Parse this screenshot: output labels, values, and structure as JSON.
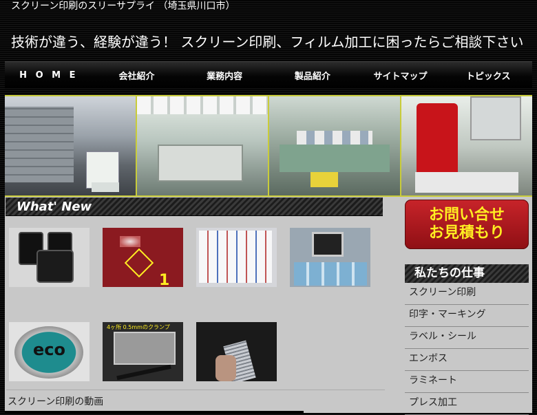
{
  "header": {
    "tagline": "スクリーン印刷のスリーサプライ （埼玉県川口市）",
    "headline": "技術が違う、経験が違う！ スクリーン印刷、フィルム加工に困ったらご相談下さい"
  },
  "nav": {
    "items": [
      {
        "label": "H O M E"
      },
      {
        "label": "会社紹介"
      },
      {
        "label": "業務内容"
      },
      {
        "label": "製品紹介"
      },
      {
        "label": "サイトマップ"
      },
      {
        "label": "トピックス"
      }
    ]
  },
  "main": {
    "whats_new_label": "What' New",
    "video_title": "スクリーン印刷の動画",
    "thumb_texts": {
      "mark_number": "1",
      "eco": "eco",
      "caption": "4ヶ所 0.5mmのクランプ"
    }
  },
  "sidebar": {
    "contact_line1": "お問い合せ",
    "contact_line2": "お見積もり",
    "heading": "私たちの仕事",
    "menu": [
      {
        "label": "スクリーン印刷"
      },
      {
        "label": "印字・マーキング"
      },
      {
        "label": "ラベル・シール"
      },
      {
        "label": "エンボス"
      },
      {
        "label": "ラミネート"
      },
      {
        "label": "プレス加工"
      }
    ]
  },
  "colors": {
    "accent_yellow": "#ffee22",
    "contact_red": "#c8242a",
    "banner_frame": "#c9cc3a"
  }
}
